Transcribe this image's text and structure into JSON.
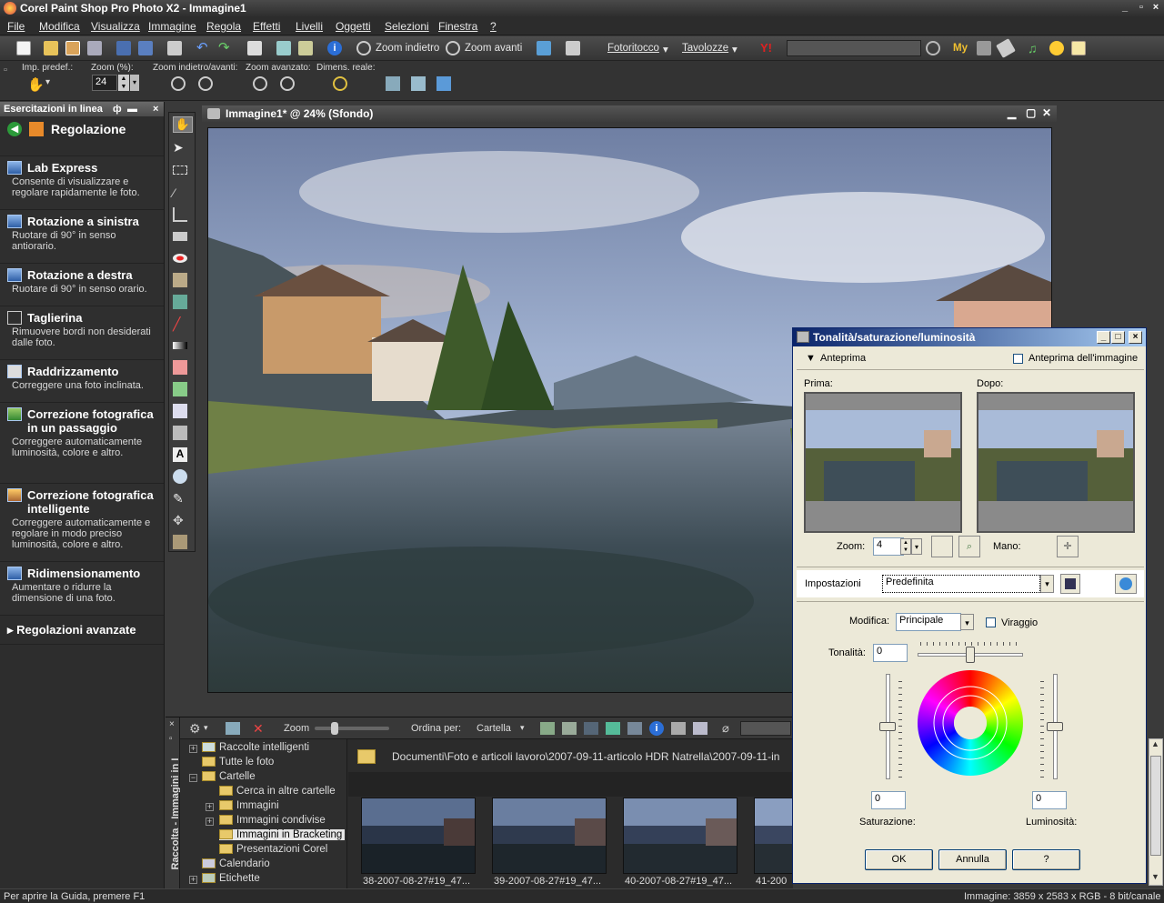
{
  "app": {
    "title": "Corel Paint Shop Pro Photo X2 - Immagine1",
    "window_controls": [
      "_",
      "▫",
      "×"
    ]
  },
  "menu": [
    "File",
    "Modifica",
    "Visualizza",
    "Immagine",
    "Regola",
    "Effetti",
    "Livelli",
    "Oggetti",
    "Selezioni",
    "Finestra",
    "?"
  ],
  "toolbar": {
    "zoom_out": "Zoom indietro",
    "zoom_in": "Zoom avanti",
    "fotoritocco": "Fotoritocco",
    "tavolozze": "Tavolozze",
    "my_label": "My",
    "search_value": ""
  },
  "options": {
    "presets_label": "Imp. predef.:",
    "zoom_pct_label": "Zoom (%):",
    "zoom_pct_value": "24",
    "zoom_inout_label": "Zoom indietro/avanti:",
    "zoom_adv_label": "Zoom avanzato:",
    "real_size_label": "Dimens. reale:"
  },
  "left_panel": {
    "header": "Esercitazioni in linea",
    "header_controls": [
      "ф",
      "▬",
      "×"
    ],
    "section_title": "Regolazione",
    "items": [
      {
        "title": "Lab Express",
        "desc": "Consente di visualizzare e regolare rapidamente le foto."
      },
      {
        "title": "Rotazione a sinistra",
        "desc": "Ruotare di 90° in senso antiorario."
      },
      {
        "title": "Rotazione a destra",
        "desc": "Ruotare di 90° in senso orario."
      },
      {
        "title": "Taglierina",
        "desc": "Rimuovere bordi non desiderati dalle foto."
      },
      {
        "title": "Raddrizzamento",
        "desc": "Correggere una foto inclinata."
      },
      {
        "title": "Correzione fotografica in un passaggio",
        "desc": "Correggere automaticamente luminosità, colore e altro."
      },
      {
        "title": "Correzione fotografica intelligente",
        "desc": "Correggere automaticamente e regolare in modo preciso luminosità, colore e altro."
      },
      {
        "title": "Ridimensionamento",
        "desc": "Aumentare o ridurre la dimensione di una foto."
      }
    ],
    "advanced": "Regolazioni avanzate"
  },
  "image_window": {
    "title": "Immagine1* @  24% (Sfondo)"
  },
  "dialog": {
    "title": "Tonalità/saturazione/luminosità",
    "preview": "Anteprima",
    "image_preview": "Anteprima dell'immagine",
    "before": "Prima:",
    "after": "Dopo:",
    "zoom_label": "Zoom:",
    "zoom_value": "4",
    "hand_label": "Mano:",
    "settings_label": "Impostazioni",
    "settings_value": "Predefinita",
    "edit_label": "Modifica:",
    "edit_value": "Principale",
    "colorize": "Viraggio",
    "hue_label": "Tonalità:",
    "hue_value": "0",
    "sat_value": "0",
    "sat_label": "Saturazione:",
    "lum_value": "0",
    "lum_label": "Luminosità:",
    "ok": "OK",
    "cancel": "Annulla",
    "help": "?"
  },
  "organizer": {
    "side_label": "Raccolta - Immagini in I",
    "zoom_label": "Zoom",
    "sort_label": "Ordina per:",
    "sort_value": "Cartella",
    "path": "Documenti\\Foto e articoli lavoro\\2007-09-11-articolo HDR Natrella\\2007-09-11-in",
    "tree": [
      "Raccolte intelligenti",
      "Tutte le foto",
      "Cartelle",
      "Cerca in altre cartelle",
      "Immagini",
      "Immagini condivise",
      "Immagini in Bracketing",
      "Presentazioni Corel",
      "Calendario",
      "Etichette"
    ],
    "thumbs": [
      "38-2007-08-27#19_47...",
      "39-2007-08-27#19_47...",
      "40-2007-08-27#19_47...",
      "41-200"
    ]
  },
  "status": {
    "left": "Per aprire la Guida, premere F1",
    "right": "Immagine:  3859 x 2583 x RGB - 8 bit/canale"
  }
}
